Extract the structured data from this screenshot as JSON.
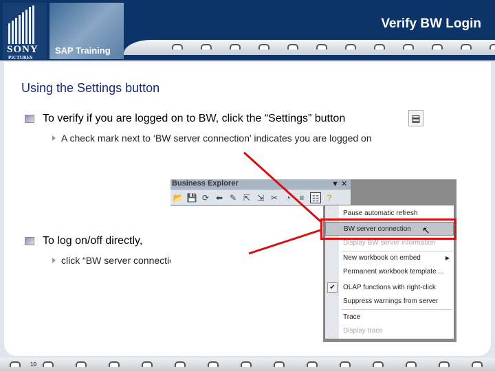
{
  "header": {
    "brand_top": "SONY",
    "brand_bottom": "PICTURES",
    "training_label": "SAP Training",
    "title": "Verify BW Login"
  },
  "content": {
    "subtitle": "Using the Settings button",
    "bullets": [
      {
        "text": "To verify if you are logged on to BW, click the “Settings” button",
        "sub": "A check mark next to ‘BW server connection’ indicates you are logged on"
      },
      {
        "text": "To log on/off directly,",
        "sub": "click “BW server connection” in the list"
      }
    ]
  },
  "screenshot": {
    "title": "Business Explorer",
    "menu_items": [
      {
        "label": "Pause automatic refresh"
      },
      {
        "label": "BW server connection",
        "highlighted": true
      },
      {
        "label": "Display BW server information",
        "disabled": true
      },
      {
        "label": "New workbook on embed",
        "submenu": true
      },
      {
        "label": "Permanent workbook template ..."
      },
      {
        "label": "OLAP functions with right-click",
        "checked": true
      },
      {
        "label": "Suppress warnings from server"
      },
      {
        "label": "Trace"
      },
      {
        "label": "Display trace",
        "disabled": true
      }
    ]
  },
  "footer": {
    "page_number": "10"
  },
  "colors": {
    "header": "#0c3468",
    "subtitle": "#1a2a7a",
    "highlight": "#d41010"
  }
}
